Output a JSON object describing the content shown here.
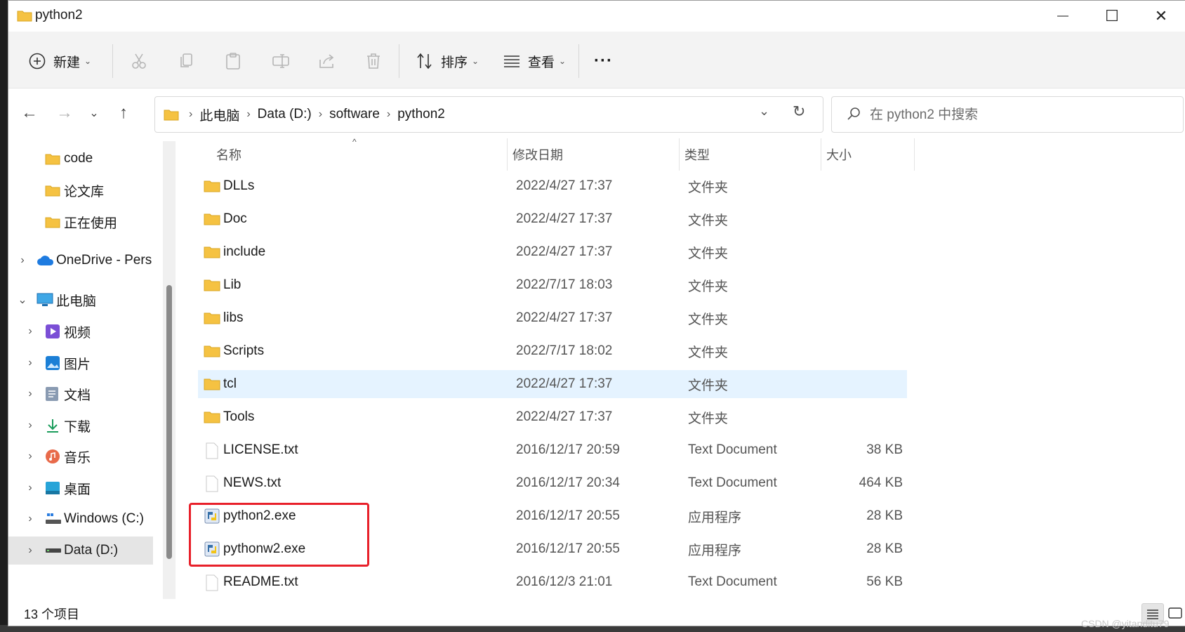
{
  "window": {
    "title": "python2",
    "minimize": "—",
    "maximize": "☐",
    "close": "✕"
  },
  "toolbar": {
    "new_label": "新建",
    "sort_label": "排序",
    "view_label": "查看",
    "more_label": "···",
    "caret": "⌄"
  },
  "nav": {
    "back": "←",
    "forward": "→",
    "recent": "⌄",
    "up": "↑"
  },
  "address": {
    "crumbs": [
      "此电脑",
      "Data (D:)",
      "software",
      "python2"
    ],
    "sep": "›",
    "dropdown": "⌄",
    "refresh": "↻"
  },
  "search": {
    "placeholder": "在 python2 中搜索"
  },
  "sidebar": {
    "items": [
      {
        "label": "code",
        "icon": "folder-icon"
      },
      {
        "label": "论文库",
        "icon": "folder-icon"
      },
      {
        "label": "正在使用",
        "icon": "folder-icon"
      },
      {
        "label": "OneDrive - Pers",
        "icon": "cloud-icon"
      },
      {
        "label": "此电脑",
        "icon": "computer-icon"
      },
      {
        "label": "视频",
        "icon": "video-icon"
      },
      {
        "label": "图片",
        "icon": "picture-icon"
      },
      {
        "label": "文档",
        "icon": "document-icon"
      },
      {
        "label": "下载",
        "icon": "download-icon"
      },
      {
        "label": "音乐",
        "icon": "music-icon"
      },
      {
        "label": "桌面",
        "icon": "desktop-icon"
      },
      {
        "label": "Windows (C:)",
        "icon": "drive-icon"
      },
      {
        "label": "Data (D:)",
        "icon": "drive-icon"
      }
    ],
    "chevron_right": "›",
    "chevron_down": "⌄"
  },
  "columns": {
    "name": "名称",
    "date": "修改日期",
    "type": "类型",
    "size": "大小",
    "sort_indicator": "^"
  },
  "files": [
    {
      "name": "DLLs",
      "date": "2022/4/27 17:37",
      "type": "文件夹",
      "size": "",
      "icon": "folder-icon"
    },
    {
      "name": "Doc",
      "date": "2022/4/27 17:37",
      "type": "文件夹",
      "size": "",
      "icon": "folder-icon"
    },
    {
      "name": "include",
      "date": "2022/4/27 17:37",
      "type": "文件夹",
      "size": "",
      "icon": "folder-icon"
    },
    {
      "name": "Lib",
      "date": "2022/7/17 18:03",
      "type": "文件夹",
      "size": "",
      "icon": "folder-icon"
    },
    {
      "name": "libs",
      "date": "2022/4/27 17:37",
      "type": "文件夹",
      "size": "",
      "icon": "folder-icon"
    },
    {
      "name": "Scripts",
      "date": "2022/7/17 18:02",
      "type": "文件夹",
      "size": "",
      "icon": "folder-icon"
    },
    {
      "name": "tcl",
      "date": "2022/4/27 17:37",
      "type": "文件夹",
      "size": "",
      "icon": "folder-icon"
    },
    {
      "name": "Tools",
      "date": "2022/4/27 17:37",
      "type": "文件夹",
      "size": "",
      "icon": "folder-icon"
    },
    {
      "name": "LICENSE.txt",
      "date": "2016/12/17 20:59",
      "type": "Text Document",
      "size": "38 KB",
      "icon": "text-file-icon"
    },
    {
      "name": "NEWS.txt",
      "date": "2016/12/17 20:34",
      "type": "Text Document",
      "size": "464 KB",
      "icon": "text-file-icon"
    },
    {
      "name": "python2.exe",
      "date": "2016/12/17 20:55",
      "type": "应用程序",
      "size": "28 KB",
      "icon": "python-exe-icon"
    },
    {
      "name": "pythonw2.exe",
      "date": "2016/12/17 20:55",
      "type": "应用程序",
      "size": "28 KB",
      "icon": "python-exe-icon"
    },
    {
      "name": "README.txt",
      "date": "2016/12/3 21:01",
      "type": "Text Document",
      "size": "56 KB",
      "icon": "text-file-icon"
    }
  ],
  "status": {
    "count": "13 个项目"
  },
  "watermark": "CSDN @yitanditu79",
  "colors": {
    "hover_row": "#e5f3ff",
    "highlight_box": "#e8202a",
    "folder": "#f5c242"
  }
}
